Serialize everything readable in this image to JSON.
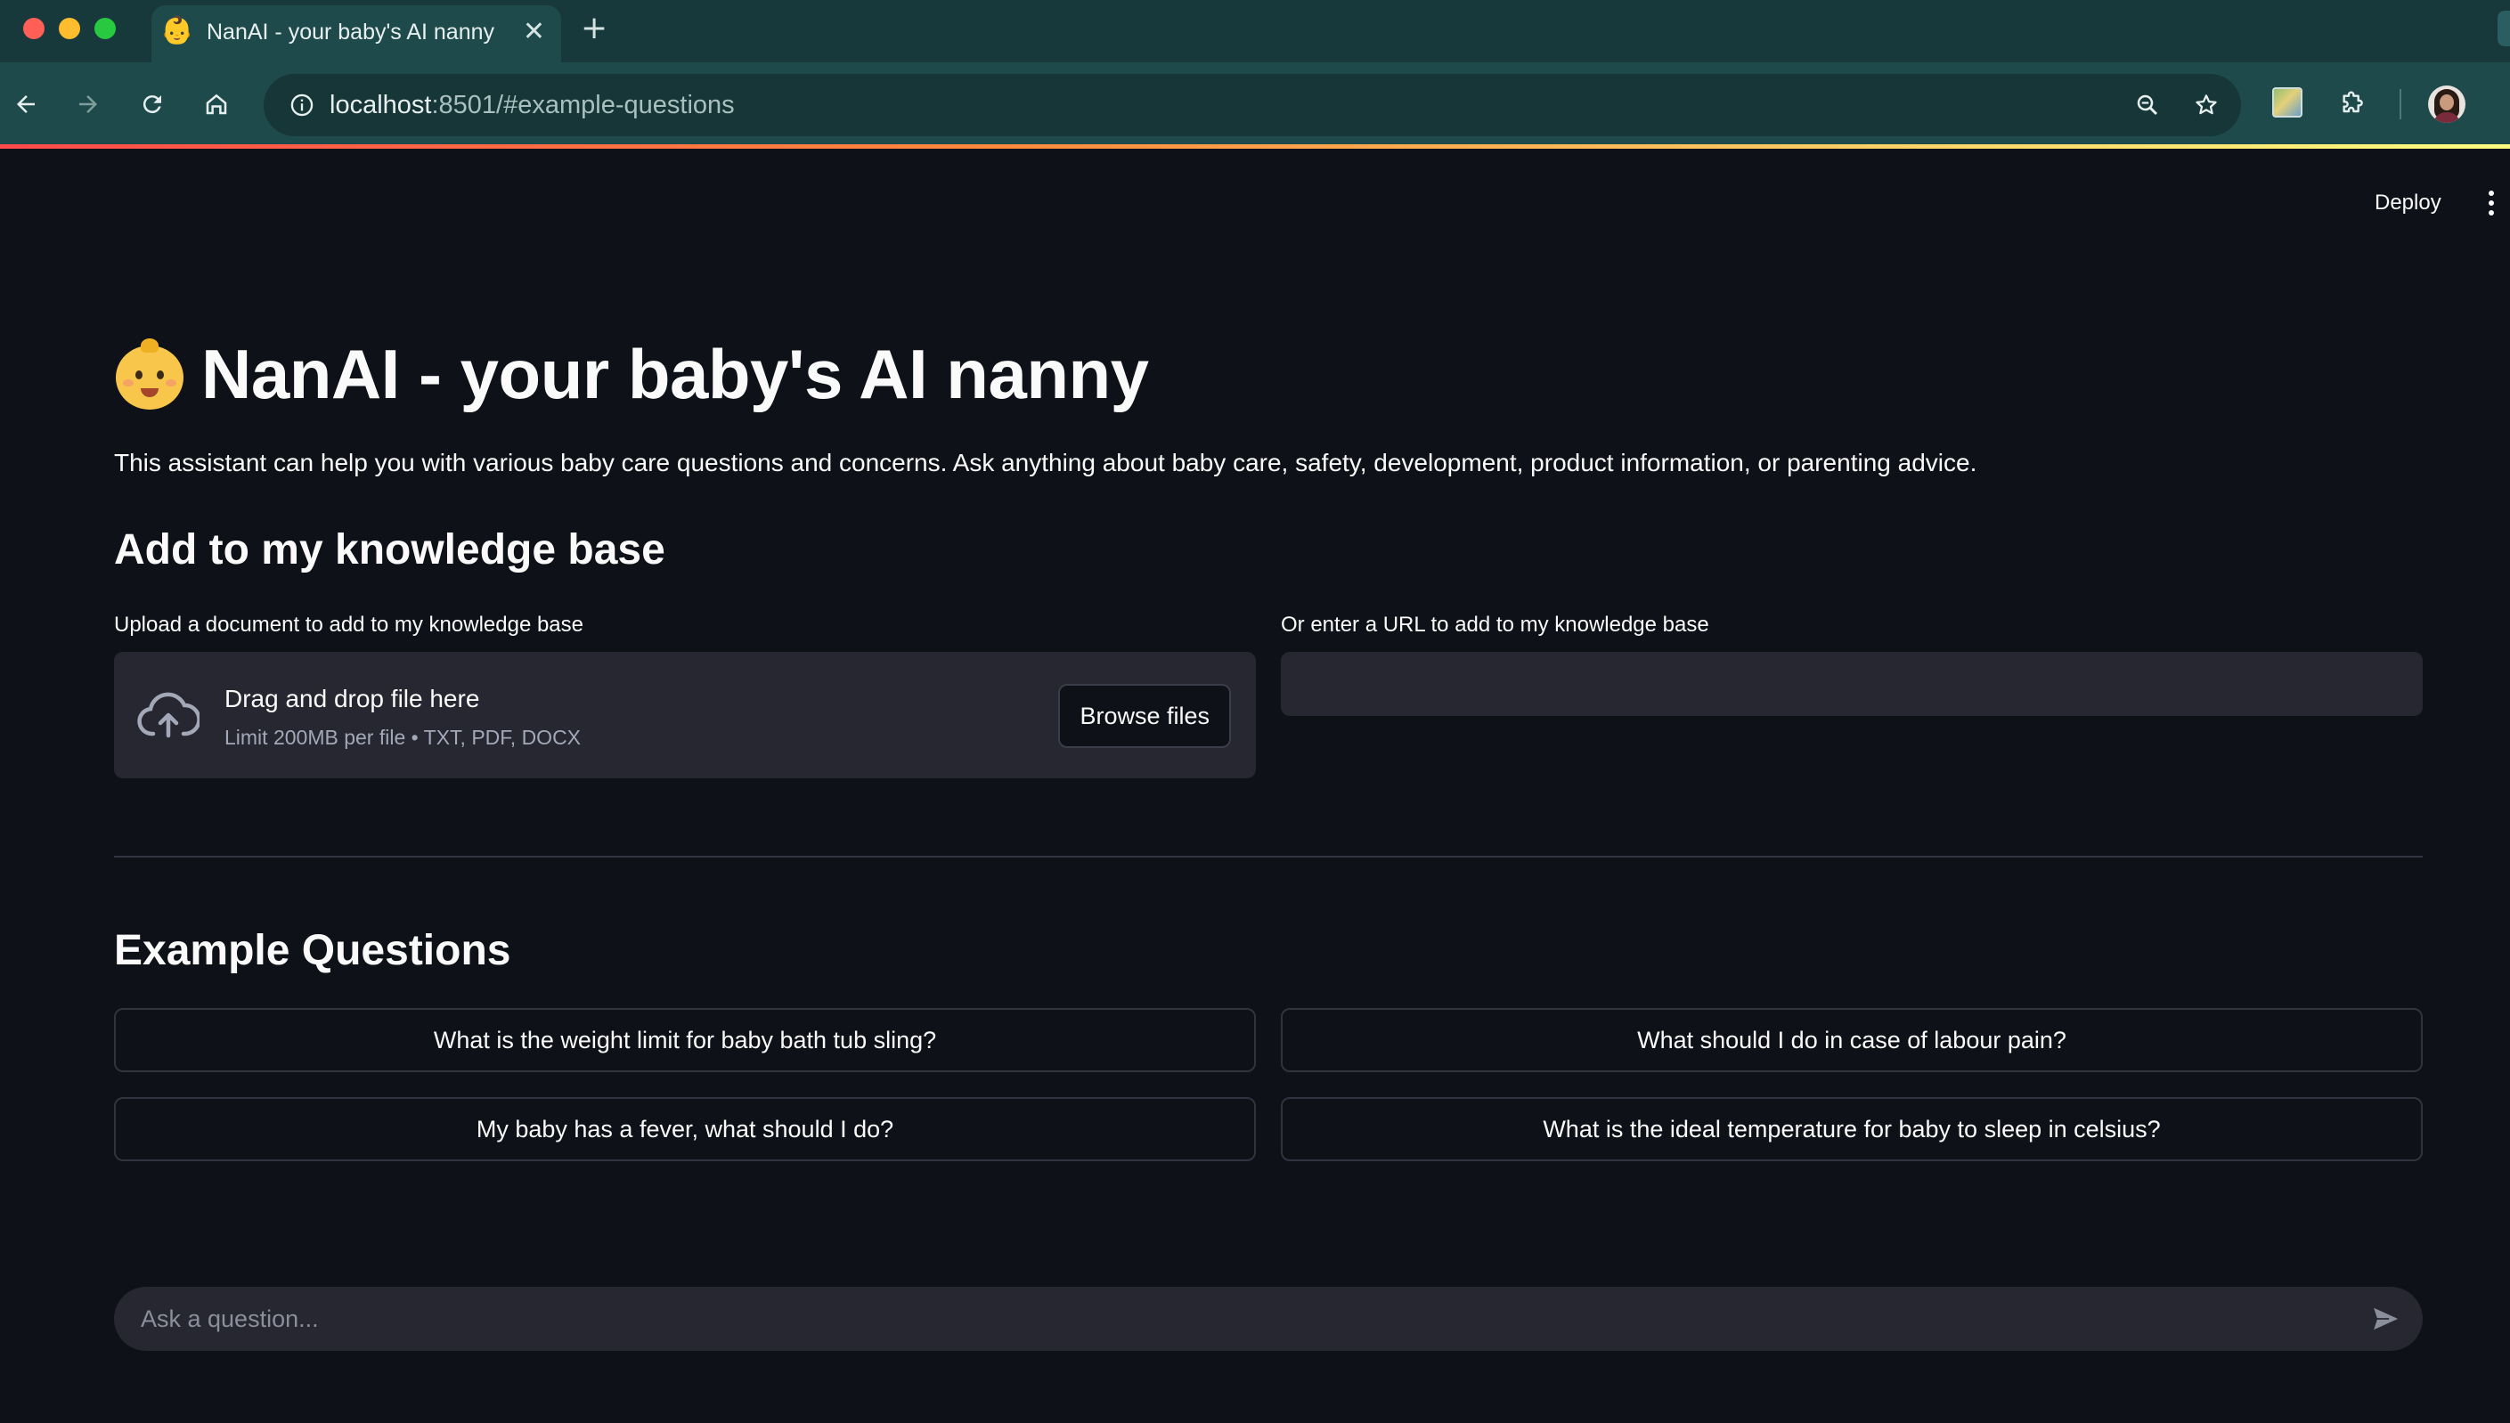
{
  "browser": {
    "tab": {
      "favicon": "👶",
      "title": "NanAI - your baby's AI nanny",
      "close_glyph": "✕"
    },
    "new_tab_glyph": "+",
    "url": {
      "host": "localhost",
      "path": ":8501/#example-questions"
    },
    "icons": [
      "back-icon",
      "forward-icon",
      "reload-icon",
      "home-icon",
      "site-info-icon",
      "zoom-icon",
      "bookmark-star-icon",
      "extension-image-icon",
      "extensions-puzzle-icon",
      "profile-avatar",
      "browser-menu-icon"
    ]
  },
  "app": {
    "deploy_label": "Deploy",
    "title_emoji": "👶",
    "title": "NanAI - your baby's AI nanny",
    "intro": "This assistant can help you with various baby care questions and concerns. Ask anything about baby care, safety, development, product information, or parenting advice.",
    "knowledge_base": {
      "heading": "Add to my knowledge base",
      "upload_label": "Upload a document to add to my knowledge base",
      "dropzone_title": "Drag and drop file here",
      "dropzone_limit": "Limit 200MB per file • TXT, PDF, DOCX",
      "browse_label": "Browse files",
      "url_label": "Or enter a URL to add to my knowledge base",
      "url_value": ""
    },
    "example_questions": {
      "heading": "Example Questions",
      "items": [
        "What is the weight limit for baby bath tub sling?",
        "What should I do in case of labour pain?",
        "My baby has a fever, what should I do?",
        "What is the ideal temperature for baby to sleep in celsius?"
      ]
    },
    "chat": {
      "placeholder": "Ask a question...",
      "value": ""
    }
  },
  "colors": {
    "background": "#0e1117",
    "surface": "#262730",
    "border": "#31333f",
    "browser_tabbar": "#17393c",
    "browser_toolbar": "#1f4a4c",
    "accent": "#ff4b4b"
  }
}
